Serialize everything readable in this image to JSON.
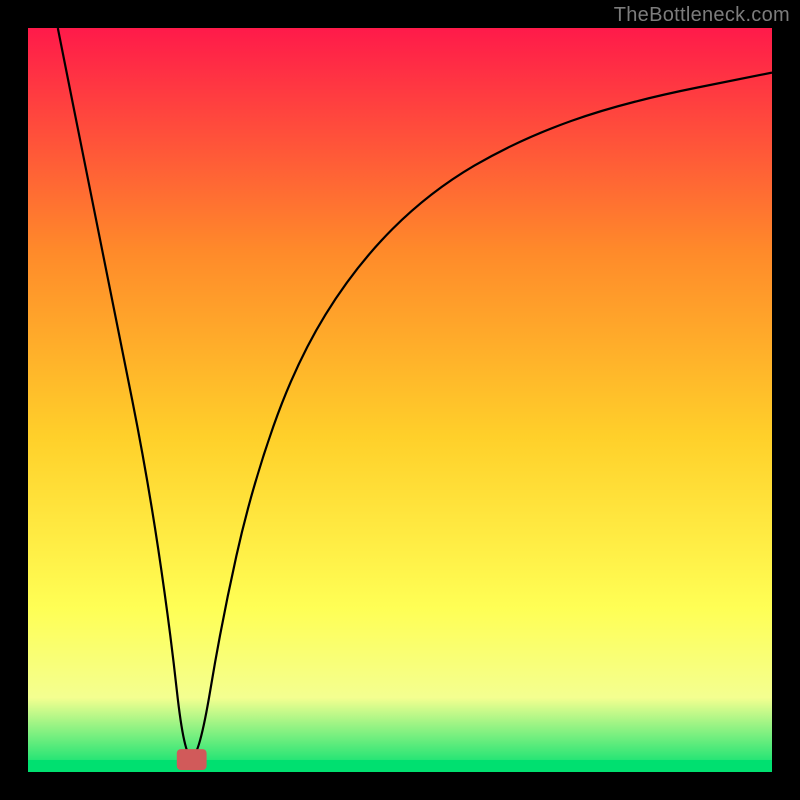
{
  "watermark": "TheBottleneck.com",
  "chart_data": {
    "type": "line",
    "title": "",
    "xlabel": "",
    "ylabel": "",
    "xlim": [
      0,
      100
    ],
    "ylim": [
      0,
      100
    ],
    "background_gradient": {
      "top": "#ff1a4a",
      "upper_mid": "#ff8a2a",
      "mid": "#ffd02a",
      "lower_mid": "#ffff55",
      "band": "#f4ff90",
      "bottom": "#00e070"
    },
    "curve": {
      "description": "V-shaped curve: steep linear drop from top-left to a minimum near x≈20, then a concave rise approaching top-right asymptotically.",
      "points_xy": [
        [
          4,
          100
        ],
        [
          8,
          80
        ],
        [
          12,
          60
        ],
        [
          16,
          40
        ],
        [
          19,
          20
        ],
        [
          21,
          2
        ],
        [
          23,
          2
        ],
        [
          26,
          20
        ],
        [
          30,
          38
        ],
        [
          36,
          55
        ],
        [
          44,
          68
        ],
        [
          54,
          78
        ],
        [
          66,
          85
        ],
        [
          80,
          90
        ],
        [
          100,
          94
        ]
      ]
    },
    "minimum_marker": {
      "x_center": 22,
      "width": 4,
      "height": 2,
      "color": "#d15a5a"
    }
  }
}
